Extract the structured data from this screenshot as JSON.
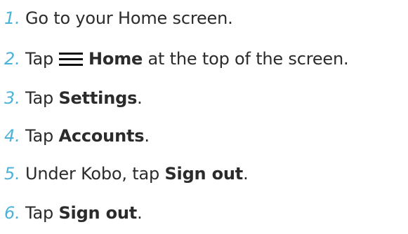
{
  "colors": {
    "step_number": "#4cb3d8",
    "text": "#2b2b2b",
    "icon": "#111111",
    "background": "#ffffff"
  },
  "steps": [
    {
      "number": "1.",
      "text": "Go to your Home screen."
    },
    {
      "number": "2.",
      "pre": "Tap",
      "icon": "menu-icon",
      "bold": "Home",
      "post": " at the top of the screen."
    },
    {
      "number": "3.",
      "pre": "Tap ",
      "bold": "Settings",
      "post": "."
    },
    {
      "number": "4.",
      "pre": "Tap ",
      "bold": "Accounts",
      "post": "."
    },
    {
      "number": "5.",
      "pre": "Under Kobo, tap ",
      "bold": "Sign out",
      "post": "."
    },
    {
      "number": "6.",
      "pre": "Tap ",
      "bold": "Sign out",
      "post": "."
    }
  ]
}
